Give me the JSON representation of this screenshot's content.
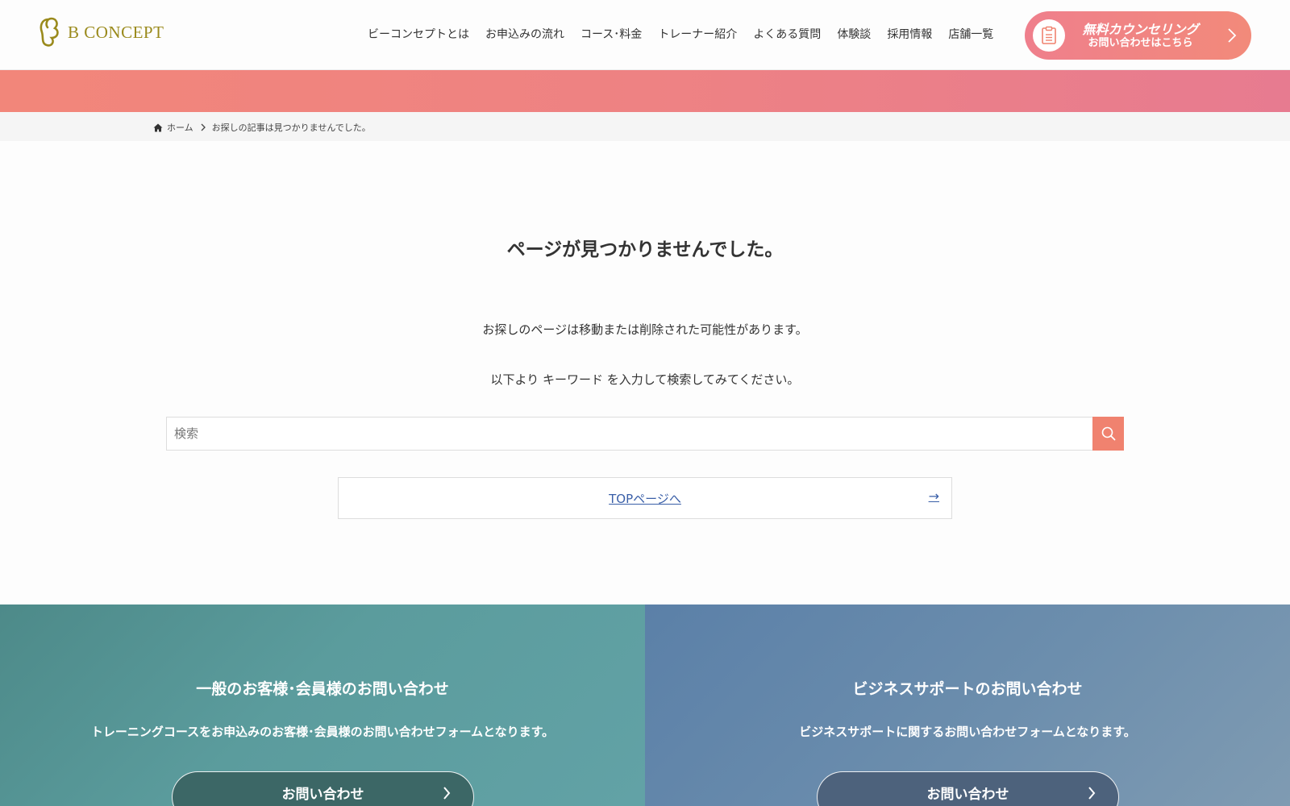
{
  "header": {
    "logo_text": "B CONCEPT",
    "nav": [
      {
        "label": "ビーコンセプトとは"
      },
      {
        "label": "お申込みの流れ"
      },
      {
        "label": "コース･料金"
      },
      {
        "label": "トレーナー紹介"
      },
      {
        "label": "よくある質問"
      },
      {
        "label": "体験談"
      },
      {
        "label": "採用情報"
      },
      {
        "label": "店舗一覧"
      }
    ],
    "cta": {
      "main": "無料カウンセリング",
      "sub": "お問い合わせはこちら",
      "icon": "clipboard-icon"
    }
  },
  "breadcrumb": {
    "home": "ホーム",
    "current": "お探しの記事は見つかりませんでした。"
  },
  "main": {
    "title": "ページが見つかりませんでした。",
    "message1": "お探しのページは移動または削除された可能性があります。",
    "message2": "以下より キーワード を入力して検索してみてください。",
    "search_placeholder": "検索",
    "search_value": "",
    "top_link": "TOPページへ",
    "top_link_arrow": "→"
  },
  "contact": {
    "general": {
      "title": "一般のお客様･会員様のお問い合わせ",
      "desc": "トレーニングコースをお申込みのお客様･会員様のお問い合わせフォームとなります。",
      "button": "お問い合わせ"
    },
    "business": {
      "title": "ビジネスサポートのお問い合わせ",
      "desc": "ビジネスサポートに関するお問い合わせフォームとなります。",
      "button": "お問い合わせ"
    }
  },
  "colors": {
    "accent": "#f0826f",
    "logo": "#9a8a1c",
    "link": "#3a5fa8"
  }
}
